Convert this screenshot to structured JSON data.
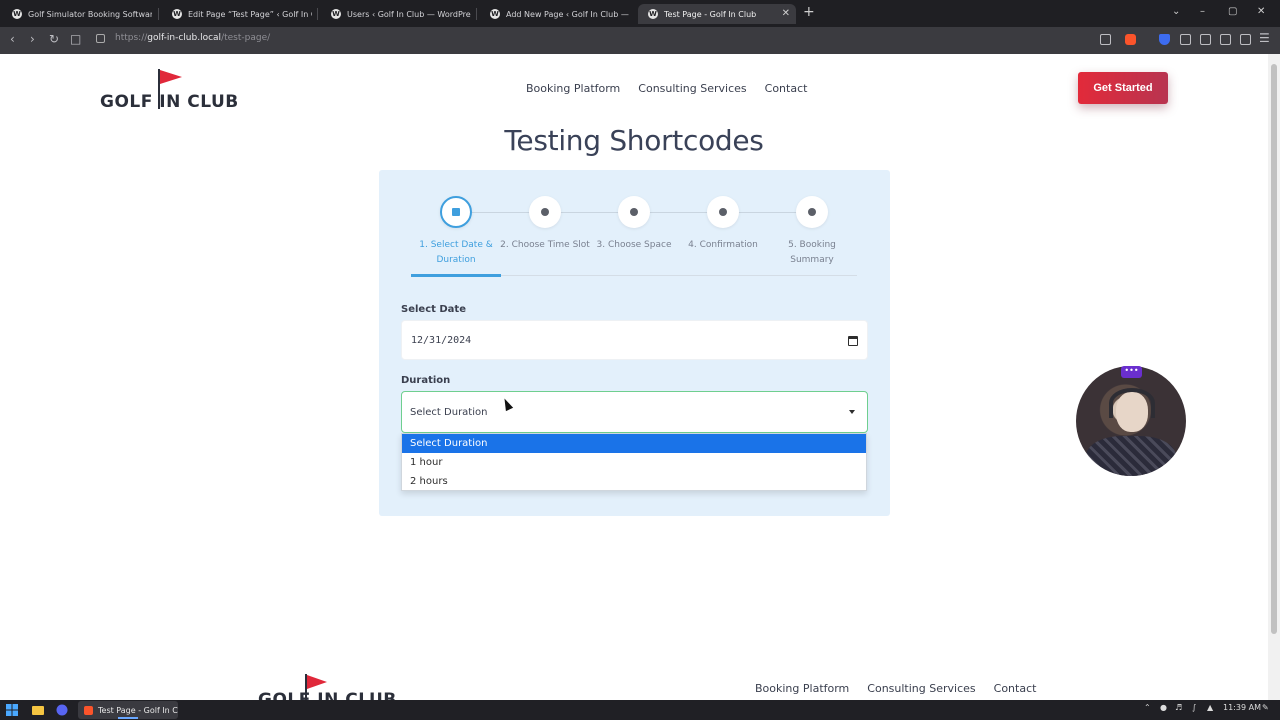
{
  "browser": {
    "tabs": [
      {
        "title": "Golf Simulator Booking Software - ",
        "active": false
      },
      {
        "title": "Edit Page “Test Page” ‹ Golf In Club",
        "active": false
      },
      {
        "title": "Users ‹ Golf In Club — WordPress",
        "active": false
      },
      {
        "title": "Add New Page ‹ Golf In Club — Wo",
        "active": false
      },
      {
        "title": "Test Page - Golf In Club",
        "active": true
      }
    ],
    "new_tab": "+",
    "tab_close": "✕",
    "window_controls": [
      "⌄",
      "–",
      "▢",
      "✕"
    ],
    "url_scheme": "https://",
    "url_host": "golf-in-club.local",
    "url_path": "/test-page/"
  },
  "site": {
    "logo_text": "GOLF IN CLUB",
    "nav": [
      "Booking Platform",
      "Consulting Services",
      "Contact"
    ],
    "cta_label": "Get Started",
    "page_title": "Testing Shortcodes"
  },
  "booking": {
    "steps": [
      {
        "label": "1. Select Date & Duration",
        "active": true,
        "icon": "calendar-icon"
      },
      {
        "label": "2. Choose Time Slot",
        "active": false,
        "icon": "clock-icon"
      },
      {
        "label": "3. Choose Space",
        "active": false,
        "icon": "location-pin-icon"
      },
      {
        "label": "4. Confirmation",
        "active": false,
        "icon": "clipboard-check-icon"
      },
      {
        "label": "5. Booking Summary",
        "active": false,
        "icon": "check-circle-icon"
      }
    ],
    "date_label": "Select Date",
    "date_value": "12/31/2024",
    "duration_label": "Duration",
    "duration_value": "Select Duration",
    "duration_options": [
      "Select Duration",
      "1 hour",
      "2 hours"
    ],
    "selected_option_index": 0
  },
  "overlay": {
    "cam_badge": "•••"
  },
  "footer": {
    "logo_text": "GOLF IN CLUB",
    "nav": [
      "Booking Platform",
      "Consulting Services",
      "Contact"
    ]
  },
  "taskbar": {
    "active_app": "Test Page - Golf In Cl...",
    "clock": "11:39 AM"
  },
  "colors": {
    "accent_blue": "#3f9fde",
    "cta_red": "#e22a3a",
    "card_bg": "#e3f0fb",
    "option_highlight": "#1a73e8"
  }
}
